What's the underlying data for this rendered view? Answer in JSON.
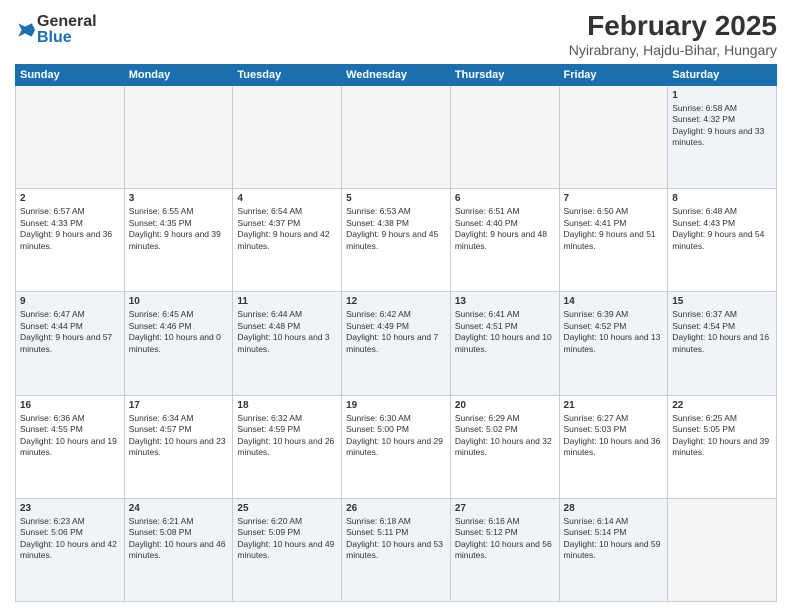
{
  "logo": {
    "general": "General",
    "blue": "Blue"
  },
  "title": {
    "month_year": "February 2025",
    "location": "Nyirabrany, Hajdu-Bihar, Hungary"
  },
  "headers": [
    "Sunday",
    "Monday",
    "Tuesday",
    "Wednesday",
    "Thursday",
    "Friday",
    "Saturday"
  ],
  "weeks": [
    [
      {
        "day": "",
        "info": ""
      },
      {
        "day": "",
        "info": ""
      },
      {
        "day": "",
        "info": ""
      },
      {
        "day": "",
        "info": ""
      },
      {
        "day": "",
        "info": ""
      },
      {
        "day": "",
        "info": ""
      },
      {
        "day": "1",
        "info": "Sunrise: 6:58 AM\nSunset: 4:32 PM\nDaylight: 9 hours and 33 minutes."
      }
    ],
    [
      {
        "day": "2",
        "info": "Sunrise: 6:57 AM\nSunset: 4:33 PM\nDaylight: 9 hours and 36 minutes."
      },
      {
        "day": "3",
        "info": "Sunrise: 6:55 AM\nSunset: 4:35 PM\nDaylight: 9 hours and 39 minutes."
      },
      {
        "day": "4",
        "info": "Sunrise: 6:54 AM\nSunset: 4:37 PM\nDaylight: 9 hours and 42 minutes."
      },
      {
        "day": "5",
        "info": "Sunrise: 6:53 AM\nSunset: 4:38 PM\nDaylight: 9 hours and 45 minutes."
      },
      {
        "day": "6",
        "info": "Sunrise: 6:51 AM\nSunset: 4:40 PM\nDaylight: 9 hours and 48 minutes."
      },
      {
        "day": "7",
        "info": "Sunrise: 6:50 AM\nSunset: 4:41 PM\nDaylight: 9 hours and 51 minutes."
      },
      {
        "day": "8",
        "info": "Sunrise: 6:48 AM\nSunset: 4:43 PM\nDaylight: 9 hours and 54 minutes."
      }
    ],
    [
      {
        "day": "9",
        "info": "Sunrise: 6:47 AM\nSunset: 4:44 PM\nDaylight: 9 hours and 57 minutes."
      },
      {
        "day": "10",
        "info": "Sunrise: 6:45 AM\nSunset: 4:46 PM\nDaylight: 10 hours and 0 minutes."
      },
      {
        "day": "11",
        "info": "Sunrise: 6:44 AM\nSunset: 4:48 PM\nDaylight: 10 hours and 3 minutes."
      },
      {
        "day": "12",
        "info": "Sunrise: 6:42 AM\nSunset: 4:49 PM\nDaylight: 10 hours and 7 minutes."
      },
      {
        "day": "13",
        "info": "Sunrise: 6:41 AM\nSunset: 4:51 PM\nDaylight: 10 hours and 10 minutes."
      },
      {
        "day": "14",
        "info": "Sunrise: 6:39 AM\nSunset: 4:52 PM\nDaylight: 10 hours and 13 minutes."
      },
      {
        "day": "15",
        "info": "Sunrise: 6:37 AM\nSunset: 4:54 PM\nDaylight: 10 hours and 16 minutes."
      }
    ],
    [
      {
        "day": "16",
        "info": "Sunrise: 6:36 AM\nSunset: 4:55 PM\nDaylight: 10 hours and 19 minutes."
      },
      {
        "day": "17",
        "info": "Sunrise: 6:34 AM\nSunset: 4:57 PM\nDaylight: 10 hours and 23 minutes."
      },
      {
        "day": "18",
        "info": "Sunrise: 6:32 AM\nSunset: 4:59 PM\nDaylight: 10 hours and 26 minutes."
      },
      {
        "day": "19",
        "info": "Sunrise: 6:30 AM\nSunset: 5:00 PM\nDaylight: 10 hours and 29 minutes."
      },
      {
        "day": "20",
        "info": "Sunrise: 6:29 AM\nSunset: 5:02 PM\nDaylight: 10 hours and 32 minutes."
      },
      {
        "day": "21",
        "info": "Sunrise: 6:27 AM\nSunset: 5:03 PM\nDaylight: 10 hours and 36 minutes."
      },
      {
        "day": "22",
        "info": "Sunrise: 6:25 AM\nSunset: 5:05 PM\nDaylight: 10 hours and 39 minutes."
      }
    ],
    [
      {
        "day": "23",
        "info": "Sunrise: 6:23 AM\nSunset: 5:06 PM\nDaylight: 10 hours and 42 minutes."
      },
      {
        "day": "24",
        "info": "Sunrise: 6:21 AM\nSunset: 5:08 PM\nDaylight: 10 hours and 46 minutes."
      },
      {
        "day": "25",
        "info": "Sunrise: 6:20 AM\nSunset: 5:09 PM\nDaylight: 10 hours and 49 minutes."
      },
      {
        "day": "26",
        "info": "Sunrise: 6:18 AM\nSunset: 5:11 PM\nDaylight: 10 hours and 53 minutes."
      },
      {
        "day": "27",
        "info": "Sunrise: 6:16 AM\nSunset: 5:12 PM\nDaylight: 10 hours and 56 minutes."
      },
      {
        "day": "28",
        "info": "Sunrise: 6:14 AM\nSunset: 5:14 PM\nDaylight: 10 hours and 59 minutes."
      },
      {
        "day": "",
        "info": ""
      }
    ]
  ]
}
